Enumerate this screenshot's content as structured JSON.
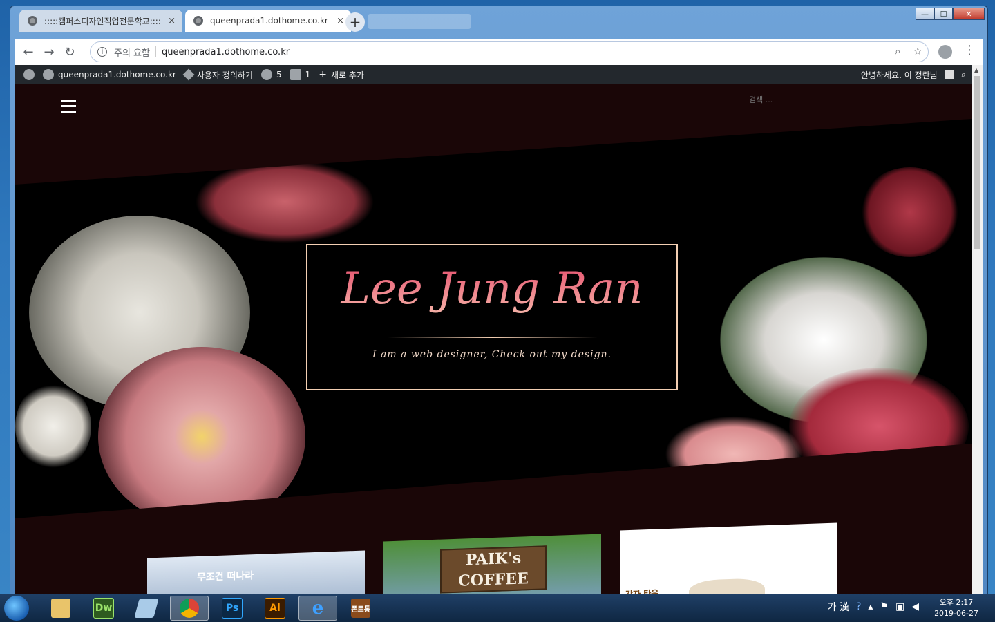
{
  "browser": {
    "tabs": [
      {
        "title": ":::::캠퍼스디자인직업전문학교:::::",
        "close": "×"
      },
      {
        "title": "queenprada1.dothome.co.kr",
        "close": "×"
      }
    ],
    "new_tab": "+",
    "nav": {
      "back": "←",
      "forward": "→",
      "reload": "↻"
    },
    "security_label": "주의 요함",
    "url": "queenprada1.dothome.co.kr",
    "info_glyph": "i",
    "zoom_icon": "⌕",
    "star_icon": "☆",
    "menu_icon": "⋮",
    "window_controls": {
      "minimize": "—",
      "maximize": "☐",
      "close": "✕"
    }
  },
  "admin_bar": {
    "site": "queenprada1.dothome.co.kr",
    "customize": "사용자 정의하기",
    "updates_count": "5",
    "comments_count": "1",
    "new_label": "새로 추가",
    "greeting": "안녕하세요. 이 정란님"
  },
  "page": {
    "search_placeholder": "검색 ...",
    "brand_title": "Lee Jung Ran",
    "brand_subtitle": "I am a web designer, Check out my design.",
    "card2_text": "PAIK's COFFEE",
    "card1_text": "무조건 떠나라",
    "card3_text": "감자 타운"
  },
  "taskbar": {
    "apps": [
      {
        "name": "explorer",
        "label": ""
      },
      {
        "name": "dreamweaver",
        "label": "Dw"
      },
      {
        "name": "notepad",
        "label": ""
      },
      {
        "name": "chrome",
        "label": ""
      },
      {
        "name": "photoshop",
        "label": "Ps"
      },
      {
        "name": "illustrator",
        "label": "Ai"
      },
      {
        "name": "ie",
        "label": "e"
      },
      {
        "name": "font-app",
        "label": "폰트통"
      }
    ],
    "ime": "가 漢",
    "clock_time": "오후 2:17",
    "clock_date": "2019-06-27"
  },
  "colors": {
    "page_bg": "#1a0607",
    "brand_gradient_top": "#e64f6d",
    "brand_gradient_bottom": "#f6b3a8",
    "brand_border": "#f3cfb3",
    "admin_bar": "#23282d"
  }
}
